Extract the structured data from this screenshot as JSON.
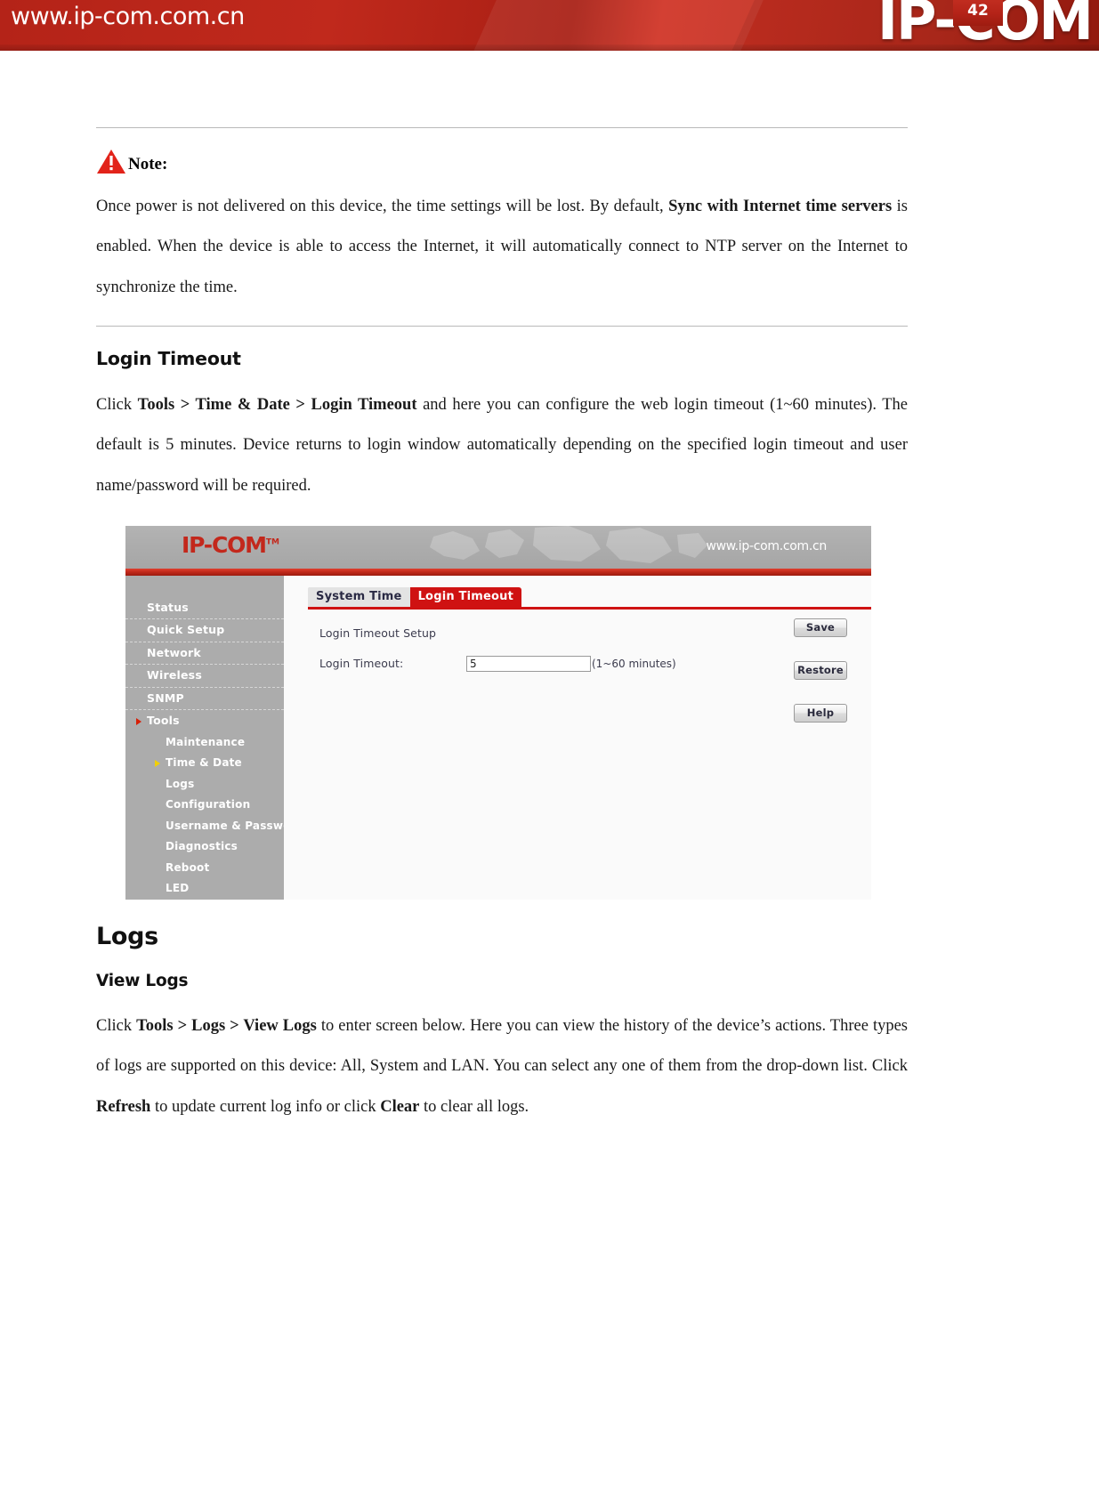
{
  "banner": {
    "url": "www.ip-com.com.cn",
    "logo": "IP-COM"
  },
  "note": {
    "icon": "warning-triangle-icon",
    "label": "Note:",
    "paragraph_pre": "Once power is not delivered on this device, the time settings will be lost. By default, ",
    "paragraph_bold1": "Sync with Internet time servers",
    "paragraph_mid": " is enabled. When the device is able to access the Internet, it will automatically connect to NTP server on the Internet to synchronize the time."
  },
  "login_timeout_section": {
    "title": "Login Timeout",
    "para_pre": "Click ",
    "para_bold": "Tools > Time & Date > Login Timeout",
    "para_post": " and here you can configure the web login timeout (1~60 minutes). The default is 5 minutes. Device returns to login window automatically depending on the specified login timeout and user name/password will be required."
  },
  "screenshot": {
    "logo": "IP-COM",
    "logo_tm": "TM",
    "url": "www.ip-com.com.cn",
    "sidebar": [
      {
        "label": "Status",
        "level": "top",
        "arrow": "none"
      },
      {
        "label": "Quick Setup",
        "level": "top",
        "arrow": "none"
      },
      {
        "label": "Network",
        "level": "top",
        "arrow": "none"
      },
      {
        "label": "Wireless",
        "level": "top",
        "arrow": "none"
      },
      {
        "label": "SNMP",
        "level": "top",
        "arrow": "none"
      },
      {
        "label": "Tools",
        "level": "top",
        "arrow": "red"
      },
      {
        "label": "Maintenance",
        "level": "sub",
        "arrow": "none"
      },
      {
        "label": "Time & Date",
        "level": "sub",
        "arrow": "yellow"
      },
      {
        "label": "Logs",
        "level": "sub",
        "arrow": "none"
      },
      {
        "label": "Configuration",
        "level": "sub",
        "arrow": "none"
      },
      {
        "label": "Username & Password",
        "level": "sub",
        "arrow": "none"
      },
      {
        "label": "Diagnostics",
        "level": "sub",
        "arrow": "none"
      },
      {
        "label": "Reboot",
        "level": "sub",
        "arrow": "none"
      },
      {
        "label": "LED",
        "level": "sub",
        "arrow": "none"
      }
    ],
    "tabs": [
      {
        "label": "System Time",
        "active": false
      },
      {
        "label": "Login Timeout",
        "active": true
      }
    ],
    "form": {
      "title": "Login Timeout Setup",
      "field_label": "Login Timeout:",
      "field_value": "5",
      "field_hint": "(1~60 minutes)"
    },
    "buttons": [
      {
        "label": "Save"
      },
      {
        "label": "Restore"
      },
      {
        "label": "Help"
      }
    ],
    "colors": {
      "brand_red": "#cf1212",
      "sidebar_gray": "#acacac",
      "header_gray": "#acacac"
    }
  },
  "logs_section": {
    "title": "Logs",
    "subtitle": "View Logs",
    "para_pre": "Click ",
    "para_bold1": "Tools > Logs > View Logs",
    "para_mid1": " to enter screen below. Here you can view the history of the device’s actions. Three types of logs are supported on this device: All, System and LAN. You can select any one of them from the drop-down list. Click ",
    "para_bold2": "Refresh",
    "para_mid2": " to update current log info or click ",
    "para_bold3": "Clear",
    "para_post": " to clear all logs."
  },
  "footer": {
    "page_number": "42"
  }
}
